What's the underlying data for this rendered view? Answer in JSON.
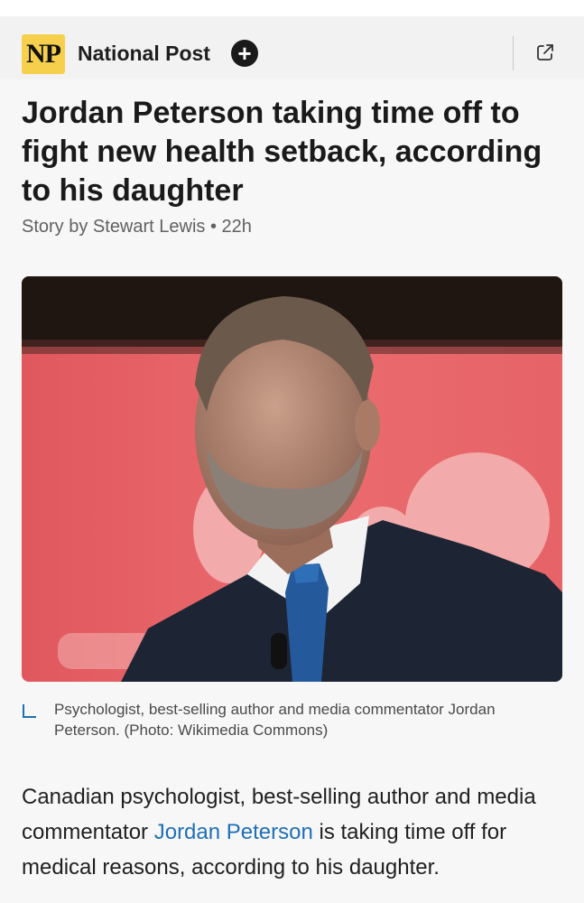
{
  "header": {
    "logo_text": "NP",
    "publisher": "National Post",
    "follow_symbol": "+",
    "share_icon": "external-link-icon"
  },
  "article": {
    "title": "Jordan Peterson taking time off to fight new health setback, according to his daughter",
    "byline": "Story by Stewart Lewis • 22h",
    "image_alt": "Jordan Peterson speaking in front of a red background",
    "caption": "Psychologist, best-selling author and media commentator Jordan Peterson. (Photo: Wikimedia Commons)",
    "body_before_link": "Canadian psychologist, best-selling author and media commentator ",
    "body_link": "Jordan Peterson",
    "body_after_link": " is taking time off for medical reasons, according to his daughter."
  },
  "colors": {
    "logo_bg": "#f6d04d",
    "link": "#1f6fb6",
    "caption_icon": "#1f6fb6"
  }
}
